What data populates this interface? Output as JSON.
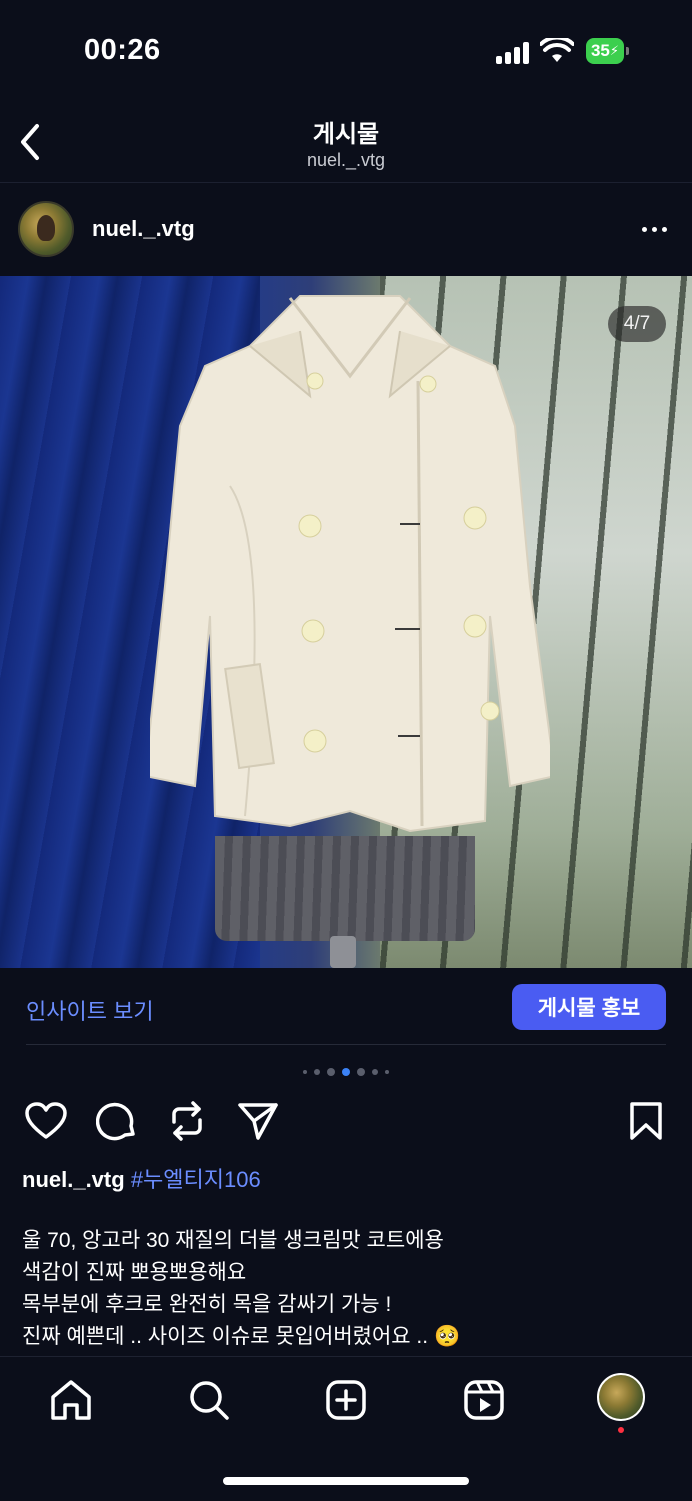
{
  "status_bar": {
    "time": "00:26",
    "battery": "35",
    "icons": [
      "cellular-signal-icon",
      "wifi-icon",
      "battery-charging-icon"
    ],
    "battery_color": "#3ccf4e"
  },
  "header": {
    "title": "게시물",
    "subtitle": "nuel._.vtg",
    "back_icon": "chevron-left-icon"
  },
  "post": {
    "author": "nuel._.vtg",
    "more_icon": "more-horizontal-icon",
    "image_counter": "4/7",
    "insights_label": "인사이트 보기",
    "promote_label": "게시물 홍보",
    "carousel": {
      "total": 7,
      "active": 4
    },
    "actions": [
      "heart-icon",
      "comment-icon",
      "repost-icon",
      "share-icon",
      "bookmark-icon"
    ],
    "caption": {
      "username": "nuel._.vtg",
      "hashtag": "#누엘티지106",
      "lines": [
        "울 70, 앙고라 30 재질의 더블 생크림맛 코트에용",
        "색감이 진짜 뽀용뽀용해요",
        "목부분에 후크로 완전히 목을 감싸기 가능 !",
        "진짜 예쁜데 .. 사이즈 이슈로 못입어버렸어요 .. 🥺"
      ]
    }
  },
  "bottom_nav": {
    "items": [
      "home-icon",
      "search-icon",
      "create-icon",
      "reels-icon",
      "profile-avatar"
    ]
  },
  "colors": {
    "background": "#0b0e1a",
    "accent_link": "#6b8dff",
    "promote_button": "#4a5cf2"
  }
}
